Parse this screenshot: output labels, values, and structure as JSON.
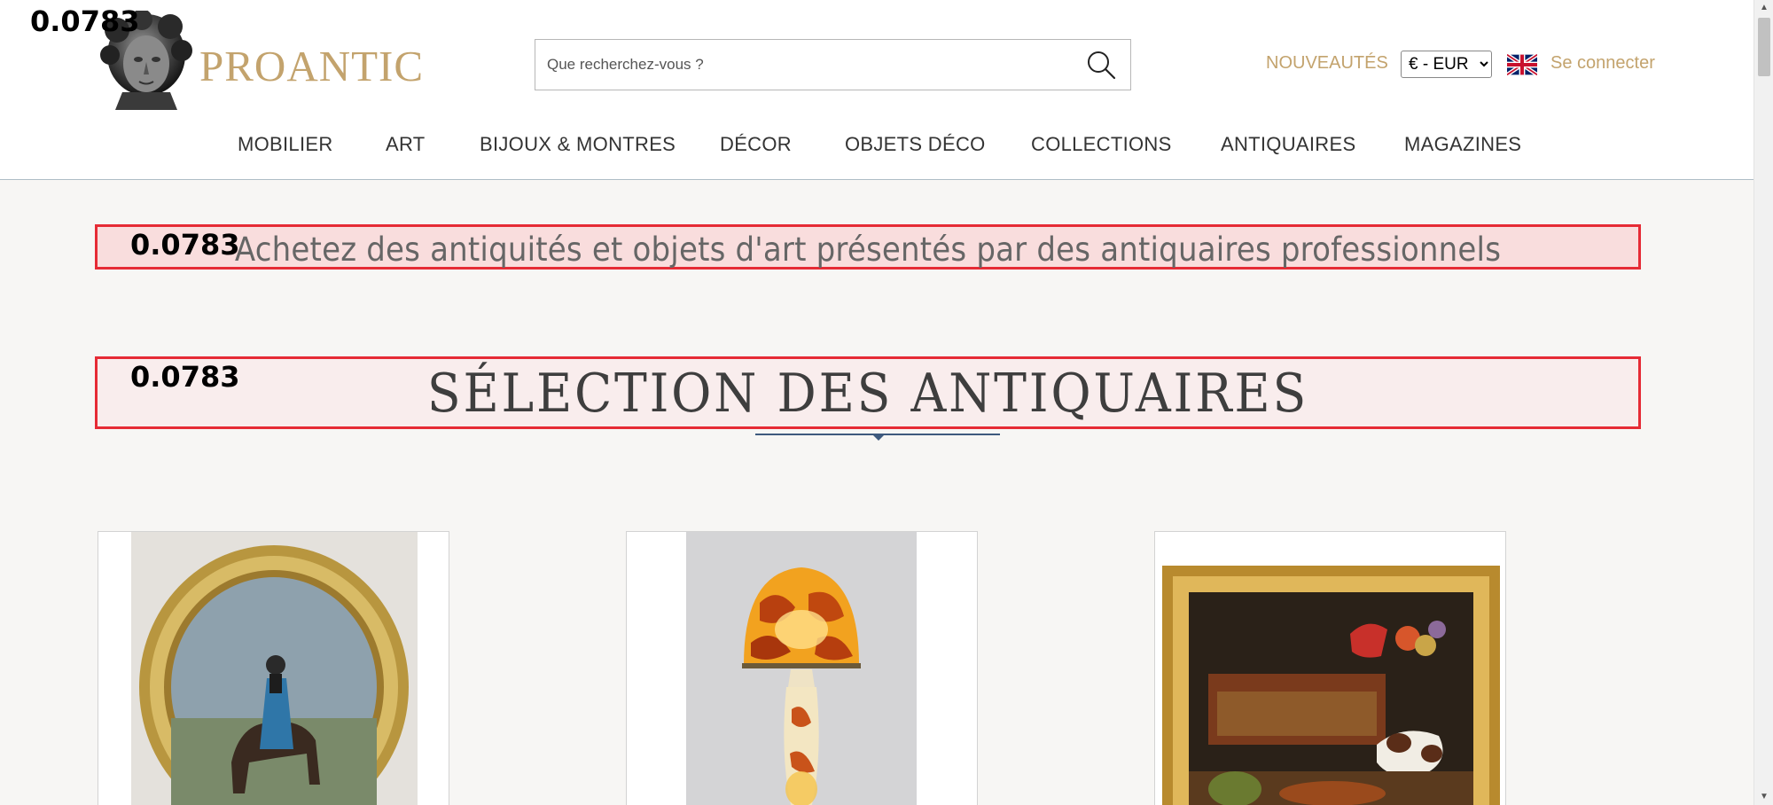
{
  "debug_score": "0.0783",
  "header": {
    "logo_text": "PROANTIC",
    "search_placeholder": "Que recherchez-vous ?",
    "new_label": "NOUVEAUTÉS",
    "currency_selected": "€ - EUR",
    "login_label": "Se connecter"
  },
  "nav": {
    "items": [
      {
        "label": "MOBILIER"
      },
      {
        "label": "ART"
      },
      {
        "label": "BIJOUX & MONTRES"
      },
      {
        "label": "DÉCOR"
      },
      {
        "label": "OBJETS DÉCO"
      },
      {
        "label": "COLLECTIONS"
      },
      {
        "label": "ANTIQUAIRES"
      },
      {
        "label": "MAGAZINES"
      }
    ]
  },
  "main": {
    "tagline": "Achetez des antiquités et objets d'art présentés par des antiquaires professionnels",
    "section_title": "SÉLECTION DES ANTIQUAIRES"
  },
  "colors": {
    "accent": "#c3a36d",
    "highlight_border": "#e62b35",
    "divider": "#3e5a7e"
  }
}
